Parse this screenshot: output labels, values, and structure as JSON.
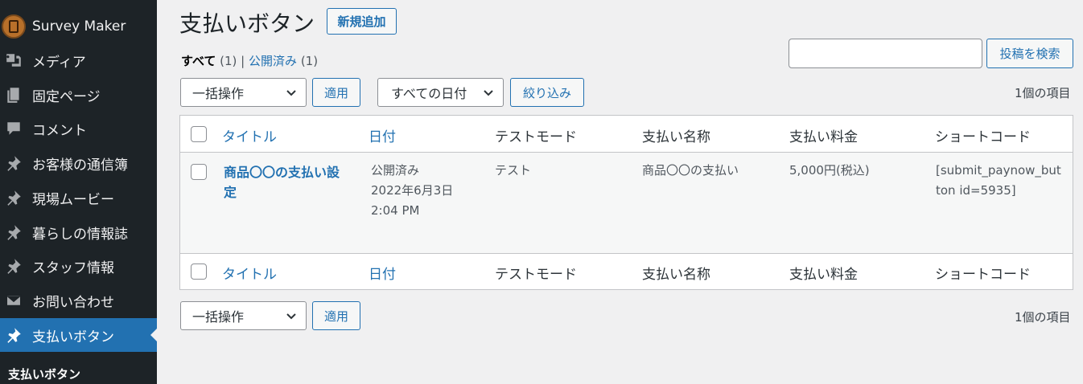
{
  "sidebar": {
    "items": [
      {
        "label": "Survey Maker",
        "icon": "survey-maker-logo"
      },
      {
        "label": "メディア",
        "icon": "media-icon"
      },
      {
        "label": "固定ページ",
        "icon": "page-icon"
      },
      {
        "label": "コメント",
        "icon": "comment-icon"
      },
      {
        "label": "お客様の通信簿",
        "icon": "pin-icon"
      },
      {
        "label": "現場ムービー",
        "icon": "pin-icon"
      },
      {
        "label": "暮らしの情報誌",
        "icon": "pin-icon"
      },
      {
        "label": "スタッフ情報",
        "icon": "pin-icon"
      },
      {
        "label": "お問い合わせ",
        "icon": "mail-icon"
      },
      {
        "label": "支払いボタン",
        "icon": "pin-icon",
        "current": true
      }
    ],
    "submenu_title": "支払いボタン",
    "colors": {
      "background": "#1d2327",
      "current": "#2271b1"
    }
  },
  "header": {
    "title": "支払いボタン",
    "add_new_label": "新規追加"
  },
  "filters": {
    "all_label": "すべて",
    "all_count": "(1)",
    "separator": "|",
    "published_label": "公開済み",
    "published_count": "(1)"
  },
  "search": {
    "value": "",
    "button_label": "投稿を検索"
  },
  "tablenav_top": {
    "bulk_action": "一括操作",
    "apply_label": "適用",
    "date_filter": "すべての日付",
    "filter_label": "絞り込み",
    "item_count": "1個の項目"
  },
  "table": {
    "columns": [
      "タイトル",
      "日付",
      "テストモード",
      "支払い名称",
      "支払い料金",
      "ショートコード"
    ],
    "rows": [
      {
        "title": "商品〇〇の支払い設定",
        "status": "公開済み",
        "date": "2022年6月3日",
        "time": "2:04 PM",
        "test_mode": "テスト",
        "payment_name": "商品〇〇の支払い",
        "payment_fee": "5,000円(税込)",
        "shortcode": "[submit_paynow_button id=5935]"
      }
    ]
  },
  "tablenav_bottom": {
    "bulk_action": "一括操作",
    "apply_label": "適用",
    "item_count": "1個の項目"
  },
  "accent_color": "#2271b1"
}
